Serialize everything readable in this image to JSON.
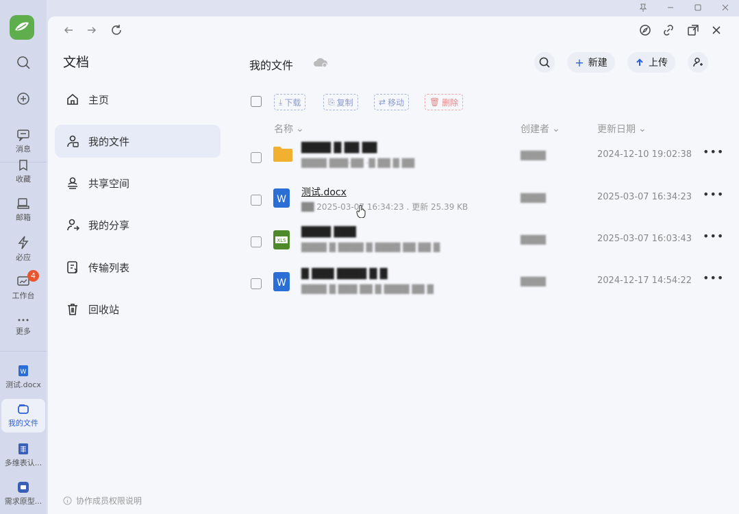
{
  "window": {
    "controls": [
      "pin",
      "minimize",
      "maximize",
      "close"
    ]
  },
  "rail": {
    "items": [
      {
        "key": "message",
        "label": "消息"
      },
      {
        "key": "favorites",
        "label": "收藏"
      },
      {
        "key": "mail",
        "label": "邮箱"
      },
      {
        "key": "apps",
        "label": "必应"
      },
      {
        "key": "workbench",
        "label": "工作台",
        "badge": "4"
      },
      {
        "key": "more",
        "label": "更多"
      },
      {
        "key": "doc-recent",
        "label": "测试.docx"
      },
      {
        "key": "my-files",
        "label": "我的文件"
      },
      {
        "key": "multi-dim",
        "label": "多维表认..."
      },
      {
        "key": "requirement",
        "label": "需求原型..."
      }
    ]
  },
  "sidebar": {
    "title": "文档",
    "items": [
      {
        "label": "主页"
      },
      {
        "label": "我的文件"
      },
      {
        "label": "共享空间"
      },
      {
        "label": "我的分享"
      },
      {
        "label": "传输列表"
      },
      {
        "label": "回收站"
      }
    ],
    "footer": "协作成员权限说明"
  },
  "content": {
    "breadcrumb": "我的文件",
    "new_label": "新建",
    "upload_label": "上传",
    "toolbar": {
      "download": "下载",
      "copy": "复制",
      "move": "移动",
      "delete": "删除"
    },
    "columns": {
      "name": "名称",
      "creator": "创建者",
      "updated": "更新日期"
    },
    "rows": [
      {
        "type": "folder",
        "name": "████ █ ██ ██",
        "meta": "████ ███·██ ·█ ██ █ ██",
        "owner": "████",
        "date": "2024-12-10 19:02:38"
      },
      {
        "type": "word",
        "name": "测试.docx",
        "meta_prefix": "██",
        "meta": "2025-03-07 16:34:23 . 更新 25.39 KB",
        "owner": "████",
        "date": "2025-03-07 16:34:23"
      },
      {
        "type": "excel",
        "name": "████ ███",
        "meta": "████ █ ████ █ ████ ██ ██ █",
        "owner": "████",
        "date": "2025-03-07 16:03:43"
      },
      {
        "type": "word",
        "name": "█ ███ ████ █ █",
        "meta": "████ █ ███ ██ █ ████ ██ █",
        "owner": "████",
        "date": "2024-12-17 14:54:22"
      }
    ],
    "more_label": "•••"
  }
}
